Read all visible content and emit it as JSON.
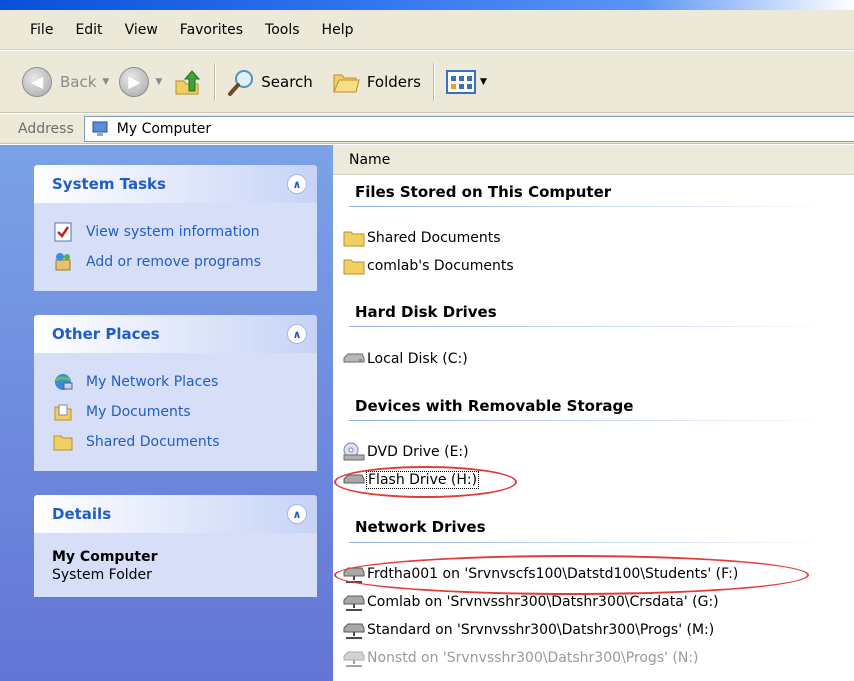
{
  "menu": [
    "File",
    "Edit",
    "View",
    "Favorites",
    "Tools",
    "Help"
  ],
  "toolbar": {
    "back_label": "Back",
    "search_label": "Search",
    "folders_label": "Folders"
  },
  "address": {
    "label": "Address",
    "value": "My Computer"
  },
  "panels": {
    "system_tasks": {
      "title": "System Tasks",
      "items": [
        "View system information",
        "Add or remove programs"
      ]
    },
    "other_places": {
      "title": "Other Places",
      "items": [
        "My Network Places",
        "My Documents",
        "Shared Documents"
      ]
    },
    "details": {
      "title": "Details",
      "name": "My Computer",
      "type": "System Folder"
    }
  },
  "content": {
    "column_header": "Name",
    "groups": {
      "files": {
        "title": "Files Stored on This Computer",
        "items": [
          "Shared Documents",
          "comlab's Documents"
        ]
      },
      "hard_disks": {
        "title": "Hard Disk Drives",
        "items": [
          "Local Disk (C:)"
        ]
      },
      "removable": {
        "title": "Devices with Removable Storage",
        "items": [
          "DVD Drive (E:)",
          "Flash Drive (H:)"
        ]
      },
      "network": {
        "title": "Network Drives",
        "items": [
          "Frdtha001 on 'Srvnvscfs100\\Datstd100\\Students' (F:)",
          "Comlab on 'Srvnvsshr300\\Datshr300\\Crsdata' (G:)",
          "Standard on 'Srvnvsshr300\\Datshr300\\Progs' (M:)",
          "Nonstd on 'Srvnvsshr300\\Datshr300\\Progs' (N:)"
        ]
      }
    }
  },
  "colors": {
    "link_blue": "#215dc6",
    "highlight_red": "#e33b3b"
  }
}
